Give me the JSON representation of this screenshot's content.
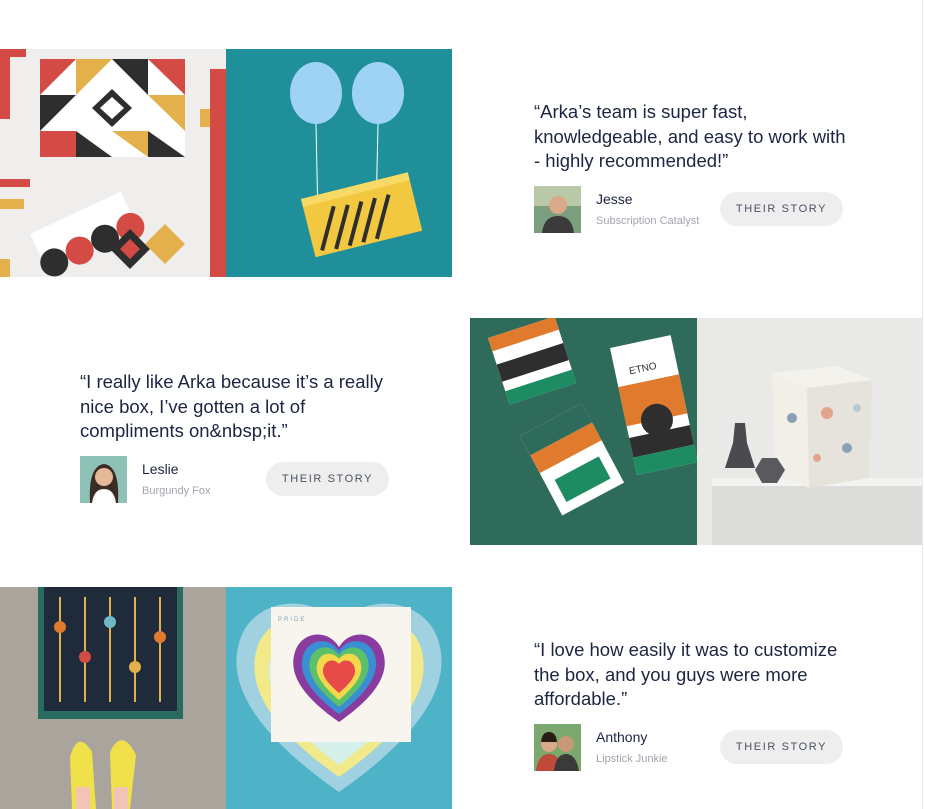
{
  "testimonials": [
    {
      "quote": "“Arka’s team is super fast, knowledgeable, and easy to work with - highly recommended!”",
      "name": "Jesse",
      "company": "Subscription Catalyst",
      "button": "THEIR STORY"
    },
    {
      "quote": "“I really like Arka because it’s a really nice box, I’ve gotten a lot of compliments on&nbsp;it.”",
      "name": "Leslie",
      "company": "Burgundy Fox",
      "button": "THEIR STORY"
    },
    {
      "quote": "“I love how easily it was to customize the box, and you guys were more affordable.”",
      "name": "Anthony",
      "company": "Lipstick Junkie",
      "button": "THEIR STORY"
    }
  ],
  "images": {
    "etno_label": "ETNO",
    "pride_label": "PRIDE"
  },
  "colors": {
    "button_bg": "#eeeeee",
    "text": "#1c2541",
    "muted": "#a0a4ad"
  }
}
